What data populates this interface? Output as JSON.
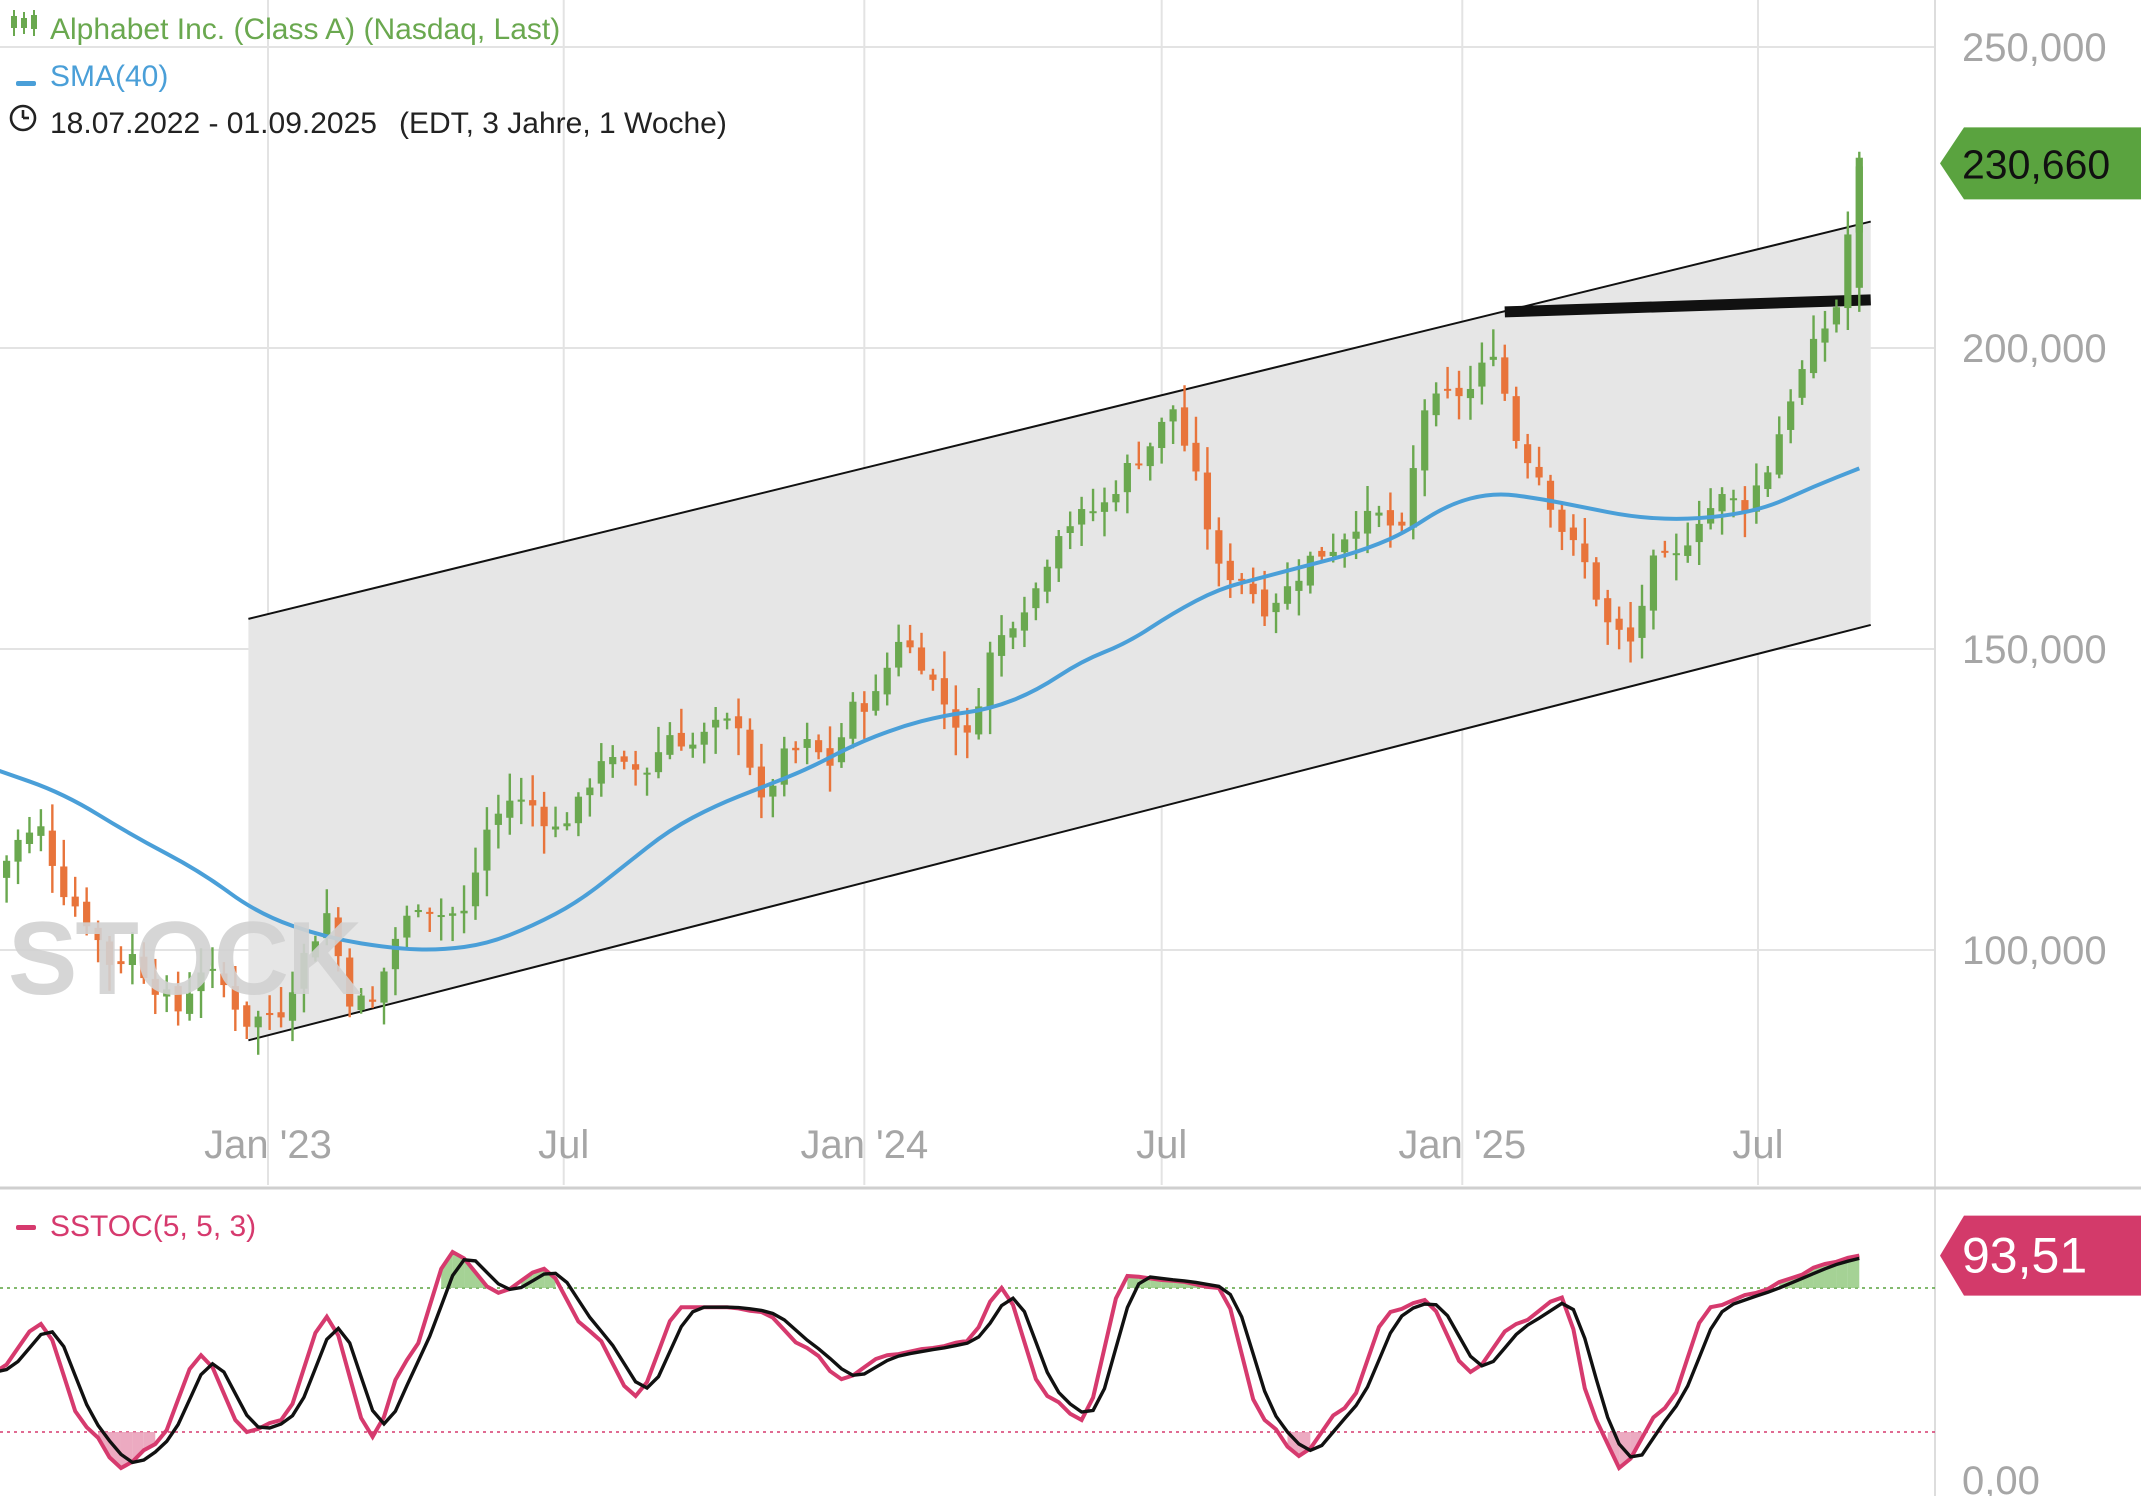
{
  "header": {
    "instrument": "Alphabet Inc. (Class A) (Nasdaq, Last)",
    "instrument_icon": "candlestick-chart-icon",
    "sma_label": "SMA(40)",
    "period": "18.07.2022 - 01.09.2025",
    "period_detail": "(EDT, 3 Jahre, 1 Woche)",
    "period_icon": "clock-icon"
  },
  "watermark": "STOCK",
  "colors": {
    "up": "#6aa84f",
    "down": "#e8743b",
    "sma": "#4a9fd8",
    "channel_fill": "#e6e6e6",
    "last_price_bg": "#5aa33f",
    "stoch_k": "#d63a6e",
    "stoch_d": "#111111",
    "stoch_badge_bg": "#d33a6a",
    "grid": "#e3e3e3",
    "axis_text": "#a6a6a6"
  },
  "oscillator": {
    "label": "SSTOC(5, 5, 3)",
    "last_value_label": "93,51",
    "axis_label": "0,00"
  },
  "chart_data": [
    {
      "type": "candlestick",
      "title": "Alphabet Inc. (Class A) (Nasdaq, Last)",
      "timeframe": "weekly",
      "x_range": [
        "2022-07-18",
        "2025-09-01"
      ],
      "x_ticks": [
        {
          "date": "2023-01-01",
          "label": "Jan '23"
        },
        {
          "date": "2023-07-01",
          "label": "Jul"
        },
        {
          "date": "2024-01-01",
          "label": "Jan '24"
        },
        {
          "date": "2024-07-01",
          "label": "Jul"
        },
        {
          "date": "2025-01-01",
          "label": "Jan '25"
        },
        {
          "date": "2025-07-01",
          "label": "Jul"
        }
      ],
      "y_ticks": [
        {
          "value": 100,
          "label": "100,000"
        },
        {
          "value": 150,
          "label": "150,000"
        },
        {
          "value": 200,
          "label": "200,000"
        },
        {
          "value": 250,
          "label": "250,000"
        }
      ],
      "ylim": [
        60,
        258
      ],
      "last_price": 230.66,
      "last_price_label": "230,660",
      "close_anchors": [
        [
          "2022-07-18",
          112
        ],
        [
          "2022-08-01",
          118
        ],
        [
          "2022-08-15",
          120
        ],
        [
          "2022-08-29",
          110
        ],
        [
          "2022-09-12",
          105
        ],
        [
          "2022-09-26",
          98
        ],
        [
          "2022-10-10",
          99
        ],
        [
          "2022-10-24",
          94
        ],
        [
          "2022-11-07",
          90
        ],
        [
          "2022-11-21",
          97
        ],
        [
          "2022-12-05",
          94
        ],
        [
          "2022-12-19",
          88
        ],
        [
          "2023-01-09",
          90
        ],
        [
          "2023-01-23",
          99
        ],
        [
          "2023-02-06",
          106
        ],
        [
          "2023-02-20",
          92
        ],
        [
          "2023-03-06",
          91
        ],
        [
          "2023-03-20",
          102
        ],
        [
          "2023-04-03",
          108
        ],
        [
          "2023-04-17",
          106
        ],
        [
          "2023-05-01",
          106
        ],
        [
          "2023-05-15",
          120
        ],
        [
          "2023-05-29",
          125
        ],
        [
          "2023-06-12",
          124
        ],
        [
          "2023-06-26",
          120
        ],
        [
          "2023-07-10",
          124
        ],
        [
          "2023-07-24",
          132
        ],
        [
          "2023-08-07",
          130
        ],
        [
          "2023-08-21",
          130
        ],
        [
          "2023-09-04",
          136
        ],
        [
          "2023-09-18",
          134
        ],
        [
          "2023-10-02",
          137
        ],
        [
          "2023-10-16",
          138
        ],
        [
          "2023-10-30",
          124
        ],
        [
          "2023-11-13",
          132
        ],
        [
          "2023-11-27",
          134
        ],
        [
          "2023-12-11",
          131
        ],
        [
          "2023-12-25",
          140
        ],
        [
          "2024-01-08",
          142
        ],
        [
          "2024-01-22",
          152
        ],
        [
          "2024-02-05",
          148
        ],
        [
          "2024-02-19",
          141
        ],
        [
          "2024-03-04",
          135
        ],
        [
          "2024-03-18",
          149
        ],
        [
          "2024-04-01",
          155
        ],
        [
          "2024-04-15",
          160
        ],
        [
          "2024-04-29",
          170
        ],
        [
          "2024-05-13",
          172
        ],
        [
          "2024-05-27",
          174
        ],
        [
          "2024-06-10",
          180
        ],
        [
          "2024-06-24",
          184
        ],
        [
          "2024-07-08",
          190
        ],
        [
          "2024-07-22",
          178
        ],
        [
          "2024-08-05",
          163
        ],
        [
          "2024-08-19",
          162
        ],
        [
          "2024-09-02",
          157
        ],
        [
          "2024-09-16",
          160
        ],
        [
          "2024-09-30",
          165
        ],
        [
          "2024-10-14",
          167
        ],
        [
          "2024-10-28",
          171
        ],
        [
          "2024-11-11",
          172
        ],
        [
          "2024-11-25",
          169
        ],
        [
          "2024-12-09",
          190
        ],
        [
          "2024-12-23",
          192
        ],
        [
          "2025-01-06",
          193
        ],
        [
          "2025-01-20",
          200
        ],
        [
          "2025-02-03",
          185
        ],
        [
          "2025-02-17",
          179
        ],
        [
          "2025-03-03",
          170
        ],
        [
          "2025-03-17",
          164
        ],
        [
          "2025-03-31",
          154
        ],
        [
          "2025-04-14",
          151
        ],
        [
          "2025-04-28",
          164
        ],
        [
          "2025-05-12",
          165
        ],
        [
          "2025-05-26",
          172
        ],
        [
          "2025-06-09",
          175
        ],
        [
          "2025-06-23",
          174
        ],
        [
          "2025-07-07",
          180
        ],
        [
          "2025-07-21",
          192
        ],
        [
          "2025-08-04",
          200
        ],
        [
          "2025-08-18",
          207
        ],
        [
          "2025-09-01",
          230.66
        ]
      ],
      "sma_series": {
        "name": "SMA(40)",
        "points": [
          [
            "2022-07-18",
            130
          ],
          [
            "2022-08-29",
            126
          ],
          [
            "2022-10-10",
            119
          ],
          [
            "2022-11-21",
            113
          ],
          [
            "2022-12-26",
            106
          ],
          [
            "2023-02-06",
            102
          ],
          [
            "2023-03-20",
            100.2
          ],
          [
            "2023-04-17",
            100
          ],
          [
            "2023-05-15",
            101
          ],
          [
            "2023-06-12",
            104
          ],
          [
            "2023-07-10",
            108
          ],
          [
            "2023-08-07",
            114
          ],
          [
            "2023-09-04",
            120
          ],
          [
            "2023-10-02",
            124
          ],
          [
            "2023-10-30",
            127
          ],
          [
            "2023-11-27",
            130
          ],
          [
            "2023-12-25",
            134
          ],
          [
            "2024-01-22",
            137
          ],
          [
            "2024-02-19",
            139
          ],
          [
            "2024-03-18",
            140
          ],
          [
            "2024-04-15",
            143
          ],
          [
            "2024-05-13",
            148
          ],
          [
            "2024-06-10",
            151
          ],
          [
            "2024-07-08",
            156
          ],
          [
            "2024-08-05",
            160
          ],
          [
            "2024-09-02",
            162
          ],
          [
            "2024-09-30",
            164
          ],
          [
            "2024-10-28",
            166
          ],
          [
            "2024-11-25",
            169
          ],
          [
            "2024-12-23",
            174
          ],
          [
            "2025-01-20",
            176
          ],
          [
            "2025-02-17",
            175
          ],
          [
            "2025-03-17",
            173.5
          ],
          [
            "2025-04-14",
            172
          ],
          [
            "2025-05-12",
            171.5
          ],
          [
            "2025-06-09",
            172
          ],
          [
            "2025-07-07",
            173.5
          ],
          [
            "2025-08-04",
            177
          ],
          [
            "2025-09-01",
            180
          ]
        ]
      },
      "trend_channel": {
        "upper": [
          [
            "2022-12-20",
            155
          ],
          [
            "2025-09-08",
            221
          ]
        ],
        "lower": [
          [
            "2022-12-20",
            85
          ],
          [
            "2025-09-08",
            154
          ]
        ],
        "resistance": [
          [
            "2025-01-27",
            206
          ],
          [
            "2025-09-08",
            208
          ]
        ]
      }
    },
    {
      "type": "line",
      "title": "SSTOC(5, 5, 3)",
      "ylim": [
        0,
        100
      ],
      "y_ticks": [
        {
          "value": 0,
          "label": "0,00"
        }
      ],
      "upper_level": 80,
      "lower_level": 20,
      "last_value": 93.51,
      "anchors": [
        [
          "2022-07-18",
          45
        ],
        [
          "2022-08-15",
          65
        ],
        [
          "2022-09-12",
          22
        ],
        [
          "2022-10-03",
          5
        ],
        [
          "2022-10-24",
          15
        ],
        [
          "2022-11-21",
          52
        ],
        [
          "2022-12-19",
          20
        ],
        [
          "2023-01-09",
          25
        ],
        [
          "2023-02-06",
          68
        ],
        [
          "2023-03-06",
          18
        ],
        [
          "2023-03-27",
          50
        ],
        [
          "2023-04-24",
          95
        ],
        [
          "2023-05-22",
          78
        ],
        [
          "2023-06-19",
          88
        ],
        [
          "2023-07-17",
          62
        ],
        [
          "2023-08-14",
          35
        ],
        [
          "2023-09-11",
          72
        ],
        [
          "2023-10-09",
          72
        ],
        [
          "2023-10-30",
          70
        ],
        [
          "2023-11-27",
          55
        ],
        [
          "2023-12-18",
          42
        ],
        [
          "2024-01-15",
          52
        ],
        [
          "2024-02-12",
          55
        ],
        [
          "2024-03-04",
          58
        ],
        [
          "2024-03-25",
          80
        ],
        [
          "2024-04-22",
          35
        ],
        [
          "2024-05-13",
          25
        ],
        [
          "2024-06-10",
          85
        ],
        [
          "2024-07-08",
          83
        ],
        [
          "2024-08-05",
          80
        ],
        [
          "2024-09-02",
          25
        ],
        [
          "2024-09-23",
          10
        ],
        [
          "2024-10-21",
          30
        ],
        [
          "2024-11-18",
          70
        ],
        [
          "2024-12-09",
          75
        ],
        [
          "2025-01-06",
          45
        ],
        [
          "2025-02-03",
          65
        ],
        [
          "2025-03-03",
          76
        ],
        [
          "2025-03-24",
          25
        ],
        [
          "2025-04-07",
          5
        ],
        [
          "2025-05-05",
          30
        ],
        [
          "2025-06-02",
          72
        ],
        [
          "2025-06-30",
          78
        ],
        [
          "2025-07-21",
          84
        ],
        [
          "2025-08-11",
          90
        ],
        [
          "2025-09-01",
          93.51
        ]
      ]
    }
  ]
}
